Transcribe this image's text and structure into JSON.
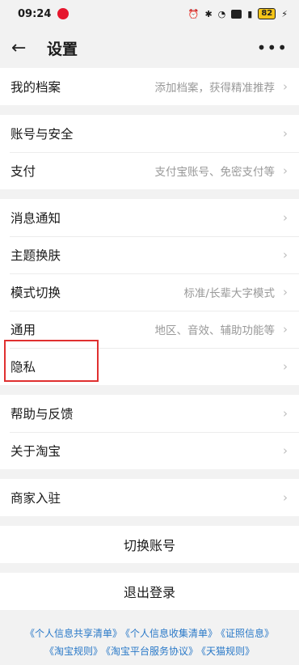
{
  "status": {
    "time": "09:24",
    "battery": "82"
  },
  "header": {
    "title": "设置",
    "back_icon": "←",
    "more_icon": "•••"
  },
  "groups": [
    [
      {
        "label": "我的档案",
        "hint": "添加档案，获得精准推荐"
      }
    ],
    [
      {
        "label": "账号与安全",
        "hint": ""
      },
      {
        "label": "支付",
        "hint": "支付宝账号、免密支付等"
      }
    ],
    [
      {
        "label": "消息通知",
        "hint": ""
      },
      {
        "label": "主题换肤",
        "hint": ""
      },
      {
        "label": "模式切换",
        "hint": "标准/长辈大字模式"
      },
      {
        "label": "通用",
        "hint": "地区、音效、辅助功能等"
      },
      {
        "label": "隐私",
        "hint": ""
      }
    ],
    [
      {
        "label": "帮助与反馈",
        "hint": ""
      },
      {
        "label": "关于淘宝",
        "hint": ""
      }
    ],
    [
      {
        "label": "商家入驻",
        "hint": ""
      }
    ]
  ],
  "actions": {
    "switch_account": "切换账号",
    "logout": "退出登录"
  },
  "footer_links": [
    [
      "《个人信息共享清单》",
      "《个人信息收集清单》",
      "《证照信息》"
    ],
    [
      "《淘宝规则》",
      "《淘宝平台服务协议》",
      "《天猫规则》"
    ]
  ],
  "colors": {
    "link": "#2a79c8",
    "highlight": "#e03030",
    "hint": "#999999"
  }
}
